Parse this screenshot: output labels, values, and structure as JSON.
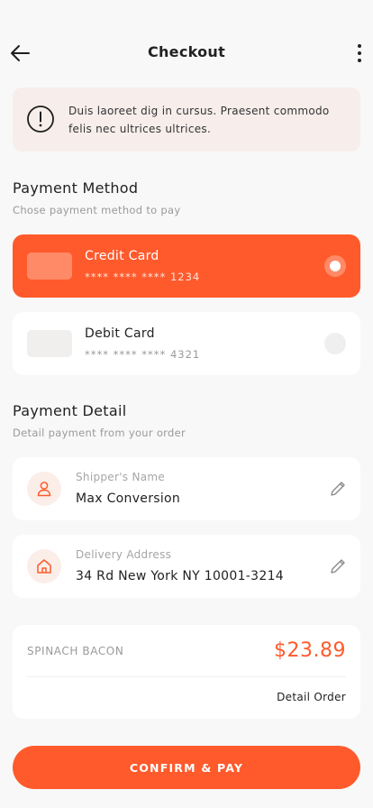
{
  "header": {
    "title": "Checkout",
    "back_icon": "arrow-left-icon",
    "menu_icon": "more-vertical-icon"
  },
  "alert": {
    "icon": "exclamation-circle-icon",
    "text": "Duis laoreet dig in cursus. Praesent commodo felis nec ultrices ultrices."
  },
  "payment_method": {
    "title": "Payment Method",
    "subtitle": "Chose payment method to pay",
    "options": [
      {
        "name": "Credit Card",
        "number": "**** **** **** 1234",
        "selected": true
      },
      {
        "name": "Debit Card",
        "number": "**** **** **** 4321",
        "selected": false
      }
    ]
  },
  "payment_detail": {
    "title": "Payment Detail",
    "subtitle": "Detail payment from your order",
    "fields": [
      {
        "label": "Shipper's Name",
        "value": "Max Conversion",
        "icon": "user-icon"
      },
      {
        "label": "Delivery Address",
        "value": "34 Rd New York NY 10001-3214",
        "icon": "home-icon"
      }
    ]
  },
  "order": {
    "item": "SPINACH BACON",
    "price": "$23.89",
    "detail_link": "Detail Order"
  },
  "confirm_button": "CONFIRM & PAY",
  "colors": {
    "accent": "#ff5a2c",
    "accent_light": "#ff8a67",
    "background": "#f8f8f8",
    "alert_bg": "#f7eeec"
  }
}
